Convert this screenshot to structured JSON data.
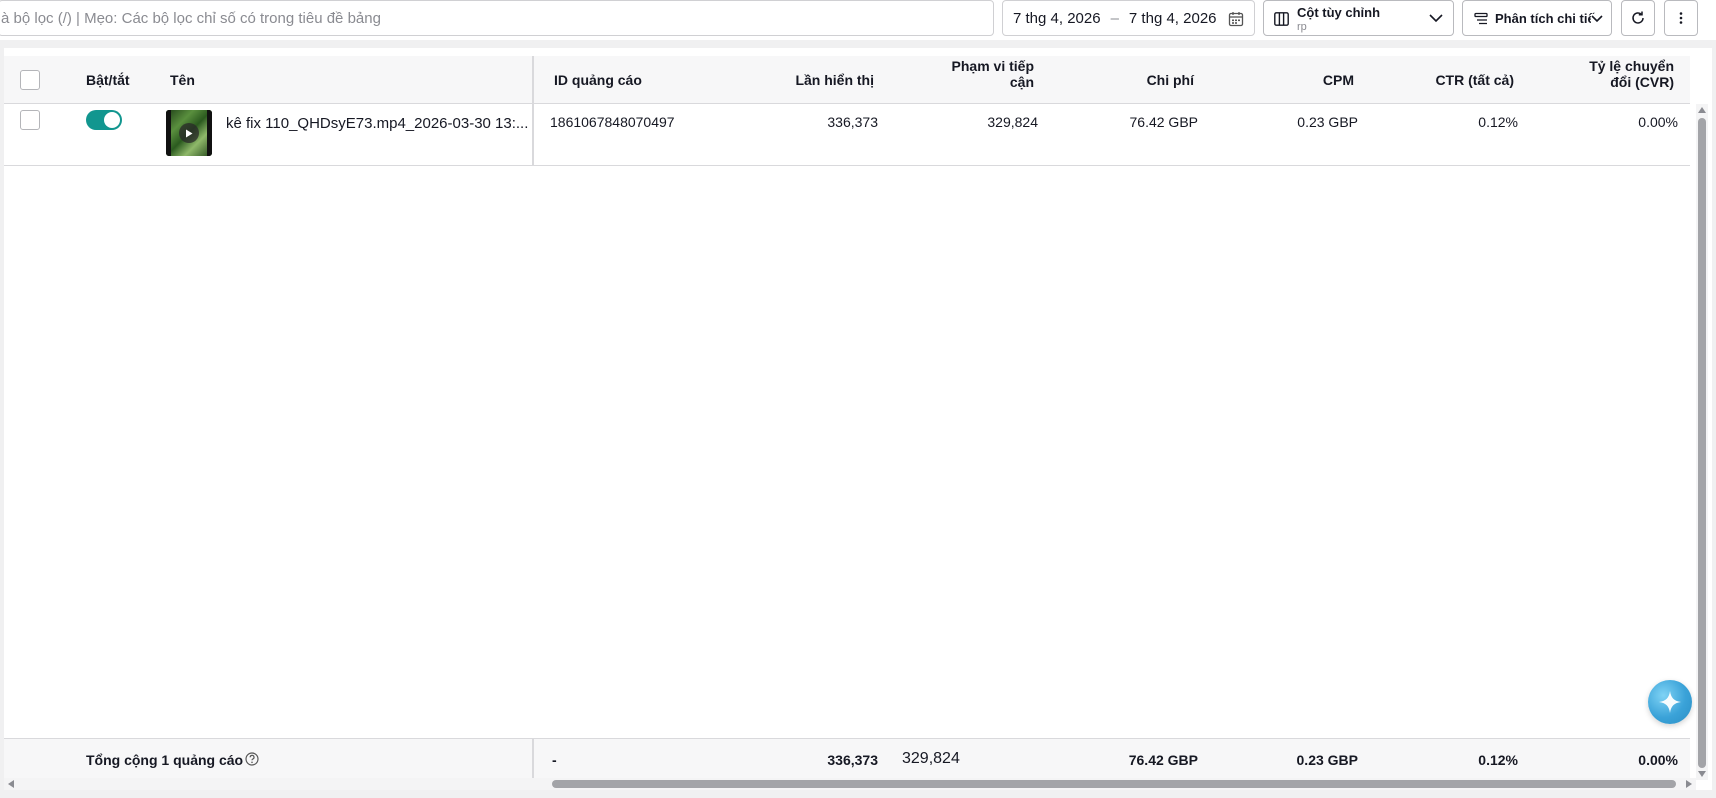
{
  "toolbar": {
    "search_placeholder": "à bộ lọc (/) | Mẹo: Các bộ lọc chỉ số có trong tiêu đề bảng",
    "date_start": "7 thg 4, 2026",
    "date_sep": "–",
    "date_end": "7 thg 4, 2026",
    "columns_label": "Cột tùy chỉnh",
    "columns_sub": "rp",
    "breakdown_label": "Phân tích chi tiết"
  },
  "table": {
    "headers": {
      "toggle": "Bật/tắt",
      "name": "Tên",
      "ad_id": "ID quảng cáo",
      "impressions": "Lần hiển thị",
      "reach_l1": "Phạm vi tiếp",
      "reach_l2": "cận",
      "cost": "Chi phí",
      "cpm": "CPM",
      "ctr": "CTR (tất cả)",
      "cvr_l1": "Tỷ lệ chuyển",
      "cvr_l2": "đổi (CVR)"
    },
    "rows": [
      {
        "enabled": true,
        "name": "kê fix 110_QHDsyE73.mp4_2026-03-30 13:...",
        "ad_id": "1861067848070497",
        "impressions": "336,373",
        "reach": "329,824",
        "cost": "76.42 GBP",
        "cpm": "0.23 GBP",
        "ctr": "0.12%",
        "cvr": "0.00%"
      }
    ],
    "footer": {
      "label": "Tổng cộng 1 quảng cáo",
      "ad_id": "-",
      "impressions": "336,373",
      "reach": "329,824",
      "cost": "76.42 GBP",
      "cpm": "0.23 GBP",
      "ctr": "0.12%",
      "cvr": "0.00%"
    }
  },
  "colors": {
    "toggle_on": "#11968f",
    "accent_ai": "#3aa2d8"
  },
  "icons": [
    "calendar-icon",
    "columns-icon",
    "chevron-down-icon",
    "breakdown-icon",
    "refresh-icon",
    "more-icon",
    "play-icon",
    "help-icon",
    "ai-assistant-icon"
  ]
}
